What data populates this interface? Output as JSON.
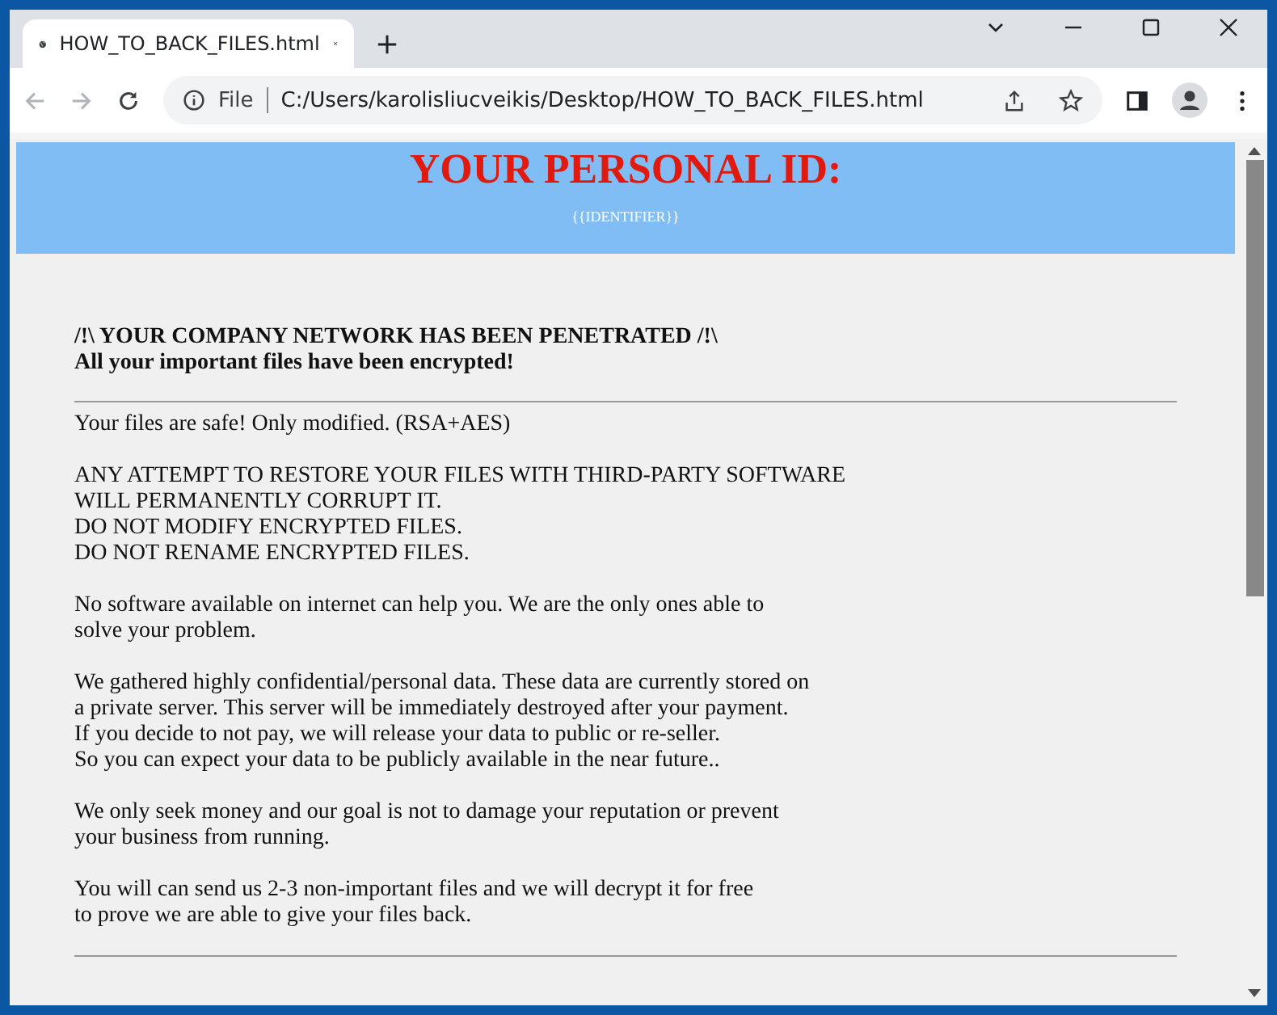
{
  "window": {
    "tab_title": "HOW_TO_BACK_FILES.html",
    "address_scheme": "File",
    "address": "C:/Users/karolisliucveikis/Desktop/HOW_TO_BACK_FILES.html"
  },
  "page": {
    "title": "YOUR PERSONAL ID:",
    "identifier": "{{IDENTIFIER}}",
    "headline": [
      "/!\\ YOUR COMPANY NETWORK HAS BEEN PENETRATED /!\\",
      "All your important files have been encrypted!"
    ],
    "paragraphs": [
      [
        "Your files are safe! Only modified. (RSA+AES)"
      ],
      [
        "ANY ATTEMPT TO RESTORE YOUR FILES WITH THIRD-PARTY SOFTWARE",
        "WILL PERMANENTLY CORRUPT IT.",
        "DO NOT MODIFY ENCRYPTED FILES.",
        "DO NOT RENAME ENCRYPTED FILES."
      ],
      [
        "No software available on internet can help you. We are the only ones able to",
        "solve your problem."
      ],
      [
        "We gathered highly confidential/personal data. These data are currently stored on",
        "a private server. This server will be immediately destroyed after your payment.",
        "If you decide to not pay, we will release your data to public or re-seller.",
        "So you can expect your data to be publicly available in the near future.."
      ],
      [
        "We only seek money and our goal is not to damage your reputation or prevent",
        "your business from running."
      ],
      [
        "You will can send us 2-3 non-important files and we will decrypt it for free",
        "to prove we are able to give your files back."
      ]
    ]
  }
}
